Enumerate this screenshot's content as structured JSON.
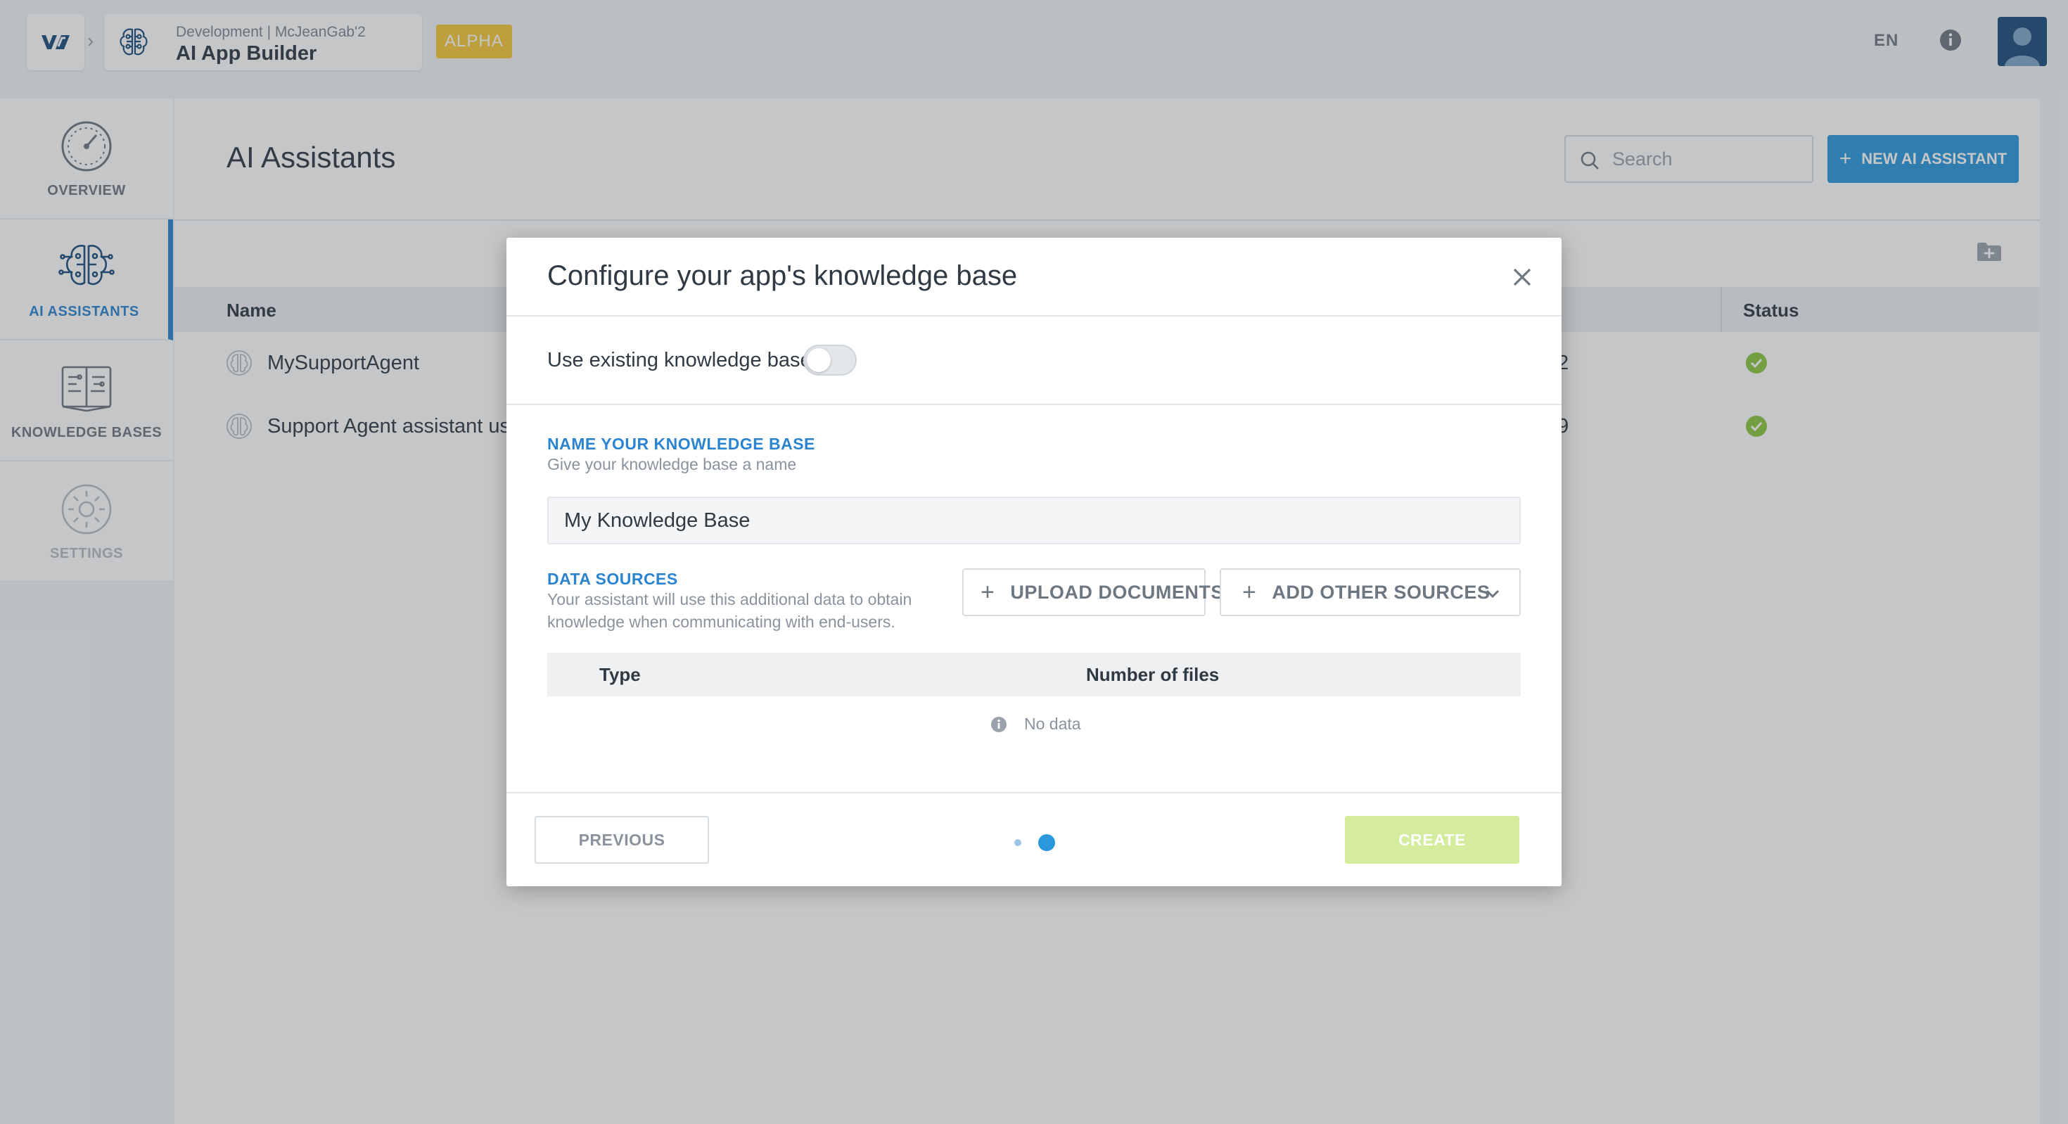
{
  "topbar": {
    "env_label": "Development | McJeanGab'2",
    "app_title": "AI App Builder",
    "badge": "ALPHA",
    "language": "EN",
    "icons": {
      "logo": "brand-logo-icon",
      "app": "brain-circuit-icon",
      "info": "info-icon",
      "avatar": "user-avatar-icon"
    }
  },
  "sidebar": {
    "items": [
      {
        "label": "OVERVIEW",
        "icon": "gauge-icon",
        "state": "normal"
      },
      {
        "label": "AI ASSISTANTS",
        "icon": "brain-circuit-icon",
        "state": "active"
      },
      {
        "label": "KNOWLEDGE BASES",
        "icon": "book-circuit-icon",
        "state": "normal"
      },
      {
        "label": "SETTINGS",
        "icon": "gear-icon",
        "state": "disabled"
      }
    ]
  },
  "main": {
    "title": "AI Assistants",
    "search_placeholder": "Search",
    "new_button_label": "NEW AI ASSISTANT",
    "table": {
      "columns": {
        "name": "Name",
        "status": "Status"
      },
      "rows": [
        {
          "name": "MySupportAgent",
          "date_fragment": "2",
          "status": "ok"
        },
        {
          "name": "Support Agent assistant using",
          "date_fragment": "9",
          "status": "ok"
        }
      ]
    }
  },
  "modal": {
    "title": "Configure your app's knowledge base",
    "toggle_label": "Use existing knowledge base",
    "toggle_on": false,
    "name_section": {
      "title": "NAME YOUR KNOWLEDGE BASE",
      "description": "Give your knowledge base a name",
      "input_value": "My Knowledge Base"
    },
    "data_sources": {
      "title": "DATA SOURCES",
      "description_line1": "Your assistant will use this additional data to obtain",
      "description_line2": "knowledge when communicating with end-users.",
      "upload_label": "UPLOAD DOCUMENTS",
      "add_sources_label": "ADD OTHER SOURCES",
      "columns": {
        "type": "Type",
        "files": "Number of files"
      },
      "empty_text": "No data"
    },
    "footer": {
      "previous_label": "PREVIOUS",
      "create_label": "CREATE",
      "steps_total": 2,
      "current_step": 2
    }
  },
  "colors": {
    "accent": "#2b84d0",
    "primary_button": "#2b97dc",
    "badge": "#f5c73a",
    "success": "#8cc63f",
    "create_disabled": "#d3ec9e"
  }
}
